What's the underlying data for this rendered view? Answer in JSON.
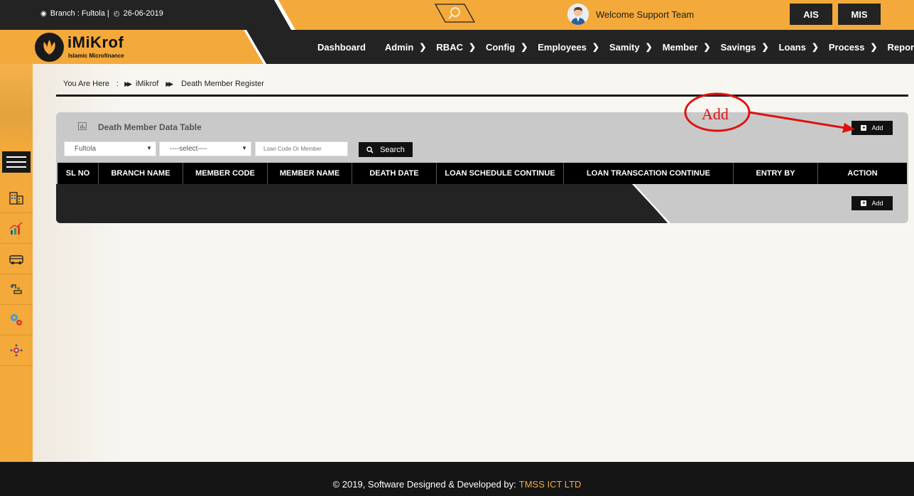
{
  "topbar": {
    "branch": "Branch : Fultola |",
    "date": "26-06-2019",
    "welcome": "Welcome Support Team",
    "ais_label": "AIS",
    "mis_label": "MIS"
  },
  "logo": {
    "name": "iMiKrof",
    "subtitle": "Islamic Microfinance"
  },
  "nav": {
    "items": [
      "Dashboard",
      "Admin",
      "RBAC",
      "Config",
      "Employees",
      "Samity",
      "Member",
      "Savings",
      "Loans",
      "Process",
      "Reports"
    ]
  },
  "breadcrumb": {
    "prefix": "You Are Here",
    "colon": ":",
    "level1": "iMikrof",
    "level2": "Death Member Register"
  },
  "panel": {
    "title": "Death Member Data Table",
    "add_label": "Add",
    "branch_select": "Fultola",
    "second_select": "----select----",
    "search_placeholder": "Loan Code Or Member",
    "search_label": "Search",
    "columns": [
      "SL NO",
      "BRANCH NAME",
      "MEMBER CODE",
      "MEMBER NAME",
      "DEATH DATE",
      "LOAN SCHEDULE CONTINUE",
      "LOAN TRANSCATION CONTINUE",
      "ENTRY BY",
      "ACTION"
    ]
  },
  "annotation": {
    "label": "Add",
    "color": "#e01010"
  },
  "footer": {
    "text": "© 2019, Software Designed & Developed by:",
    "brand": "TMSS ICT LTD"
  },
  "colors": {
    "accent": "#f4a93b",
    "dark": "#232323"
  }
}
